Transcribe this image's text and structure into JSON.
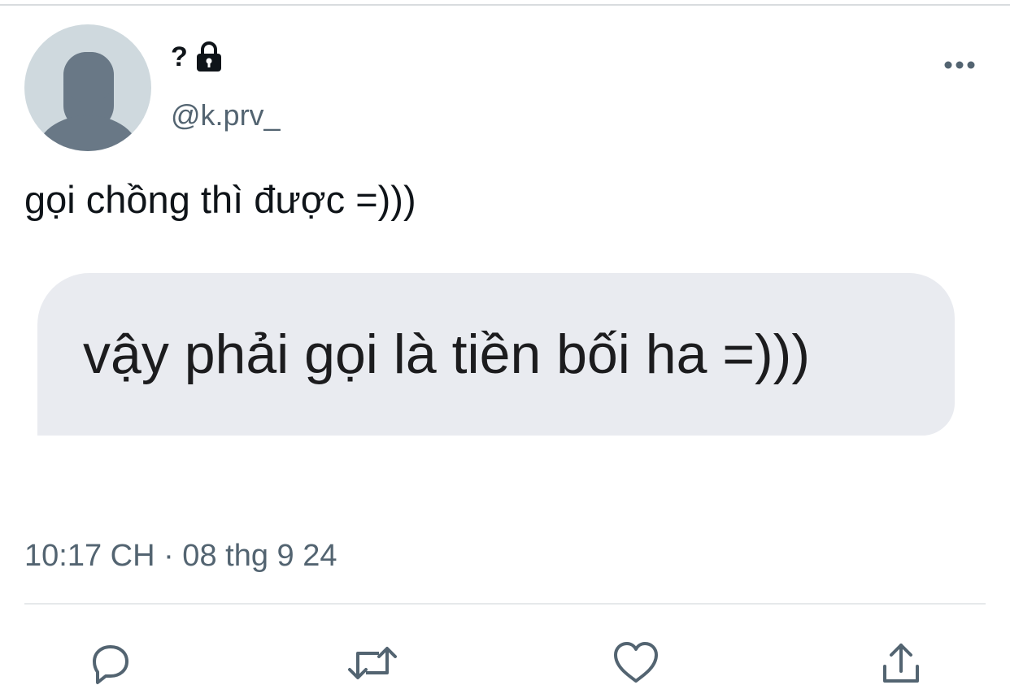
{
  "author": {
    "display_name": "?",
    "handle": "@k.prv_",
    "protected_icon": "lock-icon",
    "avatar_icon": "default-avatar-icon"
  },
  "tweet": {
    "text": "gọi chồng thì được =)))",
    "media_text": "vậy phải gọi là tiền bối ha =)))",
    "timestamp": "10:17 CH · 08 thg 9 24"
  },
  "actions": {
    "more_icon": "more-horizontal-icon",
    "reply_icon": "reply-icon",
    "retweet_icon": "retweet-icon",
    "like_icon": "heart-icon",
    "share_icon": "share-icon"
  },
  "colors": {
    "primary_text": "#0f1419",
    "secondary_text": "#536471",
    "avatar_bg": "#cfd9de",
    "avatar_figure": "#697886",
    "media_bg": "#e9ebf0",
    "icon": "#536471"
  }
}
